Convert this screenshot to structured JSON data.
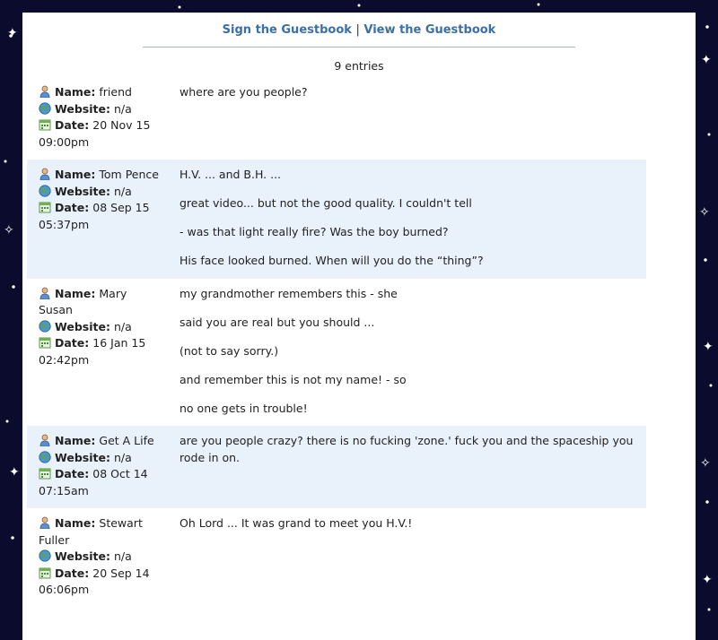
{
  "nav": {
    "sign_label": "Sign the Guestbook",
    "separator": "|",
    "view_label": "View the Guestbook",
    "link_color": "#3a6fa8"
  },
  "entry_count": "9 entries",
  "field_labels": {
    "name": "Name:",
    "website": "Website:",
    "date": "Date:"
  },
  "icons": {
    "name": "person-icon",
    "website": "globe-icon",
    "date": "calendar-icon"
  },
  "entries": [
    {
      "name": "friend",
      "website": "n/a",
      "date": "20 Nov 15",
      "time": "09:00pm",
      "message": [
        "where are you people?"
      ]
    },
    {
      "name": "Tom Pence",
      "website": "n/a",
      "date": "08 Sep 15",
      "time": "05:37pm",
      "message": [
        "H.V. ... and B.H. ...",
        "great video... but not the good quality. I couldn't tell",
        "- was that light really fire? Was the boy burned?",
        "His face looked burned. When will you do the “thing”?"
      ]
    },
    {
      "name": "Mary Susan",
      "website": "n/a",
      "date": "16 Jan 15",
      "time": "02:42pm",
      "message": [
        "my grandmother remembers this - she",
        "said you are real but you should ...",
        "(not to say sorry.)",
        "and remember this is not my name! - so",
        "no one gets in trouble!"
      ]
    },
    {
      "name": "Get A Life",
      "website": "n/a",
      "date": "08 Oct 14",
      "time": "07:15am",
      "message": [
        "are you people crazy? there is no fucking 'zone.' fuck you and the spaceship you rode in on."
      ]
    },
    {
      "name": "Stewart Fuller",
      "website": "n/a",
      "date": "20 Sep 14",
      "time": "06:06pm",
      "message": [
        "Oh Lord ...  It was grand to meet you H.V.!"
      ]
    }
  ],
  "colors": {
    "shaded_row": "#e9f1fb",
    "background": "#0b0b2e"
  }
}
